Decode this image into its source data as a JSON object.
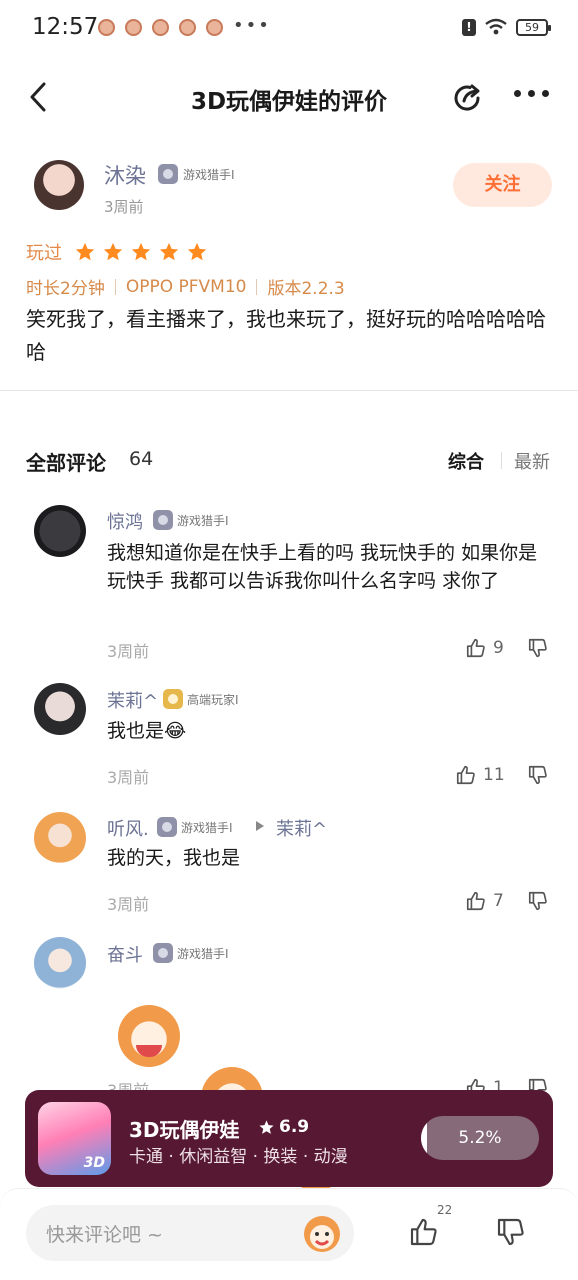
{
  "status_bar": {
    "time": "12:57",
    "more": "•••",
    "battery": "59",
    "alert": "!"
  },
  "header": {
    "title": "3D玩偶伊娃的评价"
  },
  "review": {
    "author": "沐染",
    "badge": "游戏猎手Ⅰ",
    "time": "3周前",
    "follow": "关注",
    "played_label": "玩过",
    "stars": 5,
    "duration": "时长2分钟",
    "device": "OPPO PFVM10",
    "version": "版本2.2.3",
    "text": "笑死我了，看主播来了，我也来玩了，挺好玩的哈哈哈哈哈哈"
  },
  "comments_header": {
    "title": "全部评论",
    "count": "64",
    "sort_default": "综合",
    "sort_latest": "最新"
  },
  "comments": [
    {
      "name": "惊鸿",
      "badge": "游戏猎手Ⅰ",
      "text": "我想知道你是在快手上看的吗 我玩快手的 如果你是玩快手 我都可以告诉我你叫什么名字吗 求你了",
      "time": "3周前",
      "likes": "9"
    },
    {
      "name": "茉莉^",
      "badge": "高端玩家Ⅰ",
      "text": "我也是😂",
      "time": "3周前",
      "likes": "11"
    },
    {
      "name": "听风.",
      "badge": "游戏猎手Ⅰ",
      "reply_to": "茉莉^",
      "text": "我的天，我也是",
      "time": "3周前",
      "likes": "7"
    },
    {
      "name": "奋斗",
      "badge": "游戏猎手Ⅰ",
      "time": "3周前",
      "likes": "1"
    }
  ],
  "game": {
    "name": "3D玩偶伊娃",
    "rating": "6.9",
    "tags": "卡通 · 休闲益智 · 换装 · 动漫",
    "progress": "5.2%",
    "progress_fraction": 0.052,
    "icon_text": "3D"
  },
  "bottom": {
    "placeholder": "快来评论吧 ~",
    "like_count": "22"
  },
  "colors": {
    "accent": "#ff6e34",
    "star": "#ff8a1f",
    "username": "#6c7395",
    "banner": "#561832"
  }
}
